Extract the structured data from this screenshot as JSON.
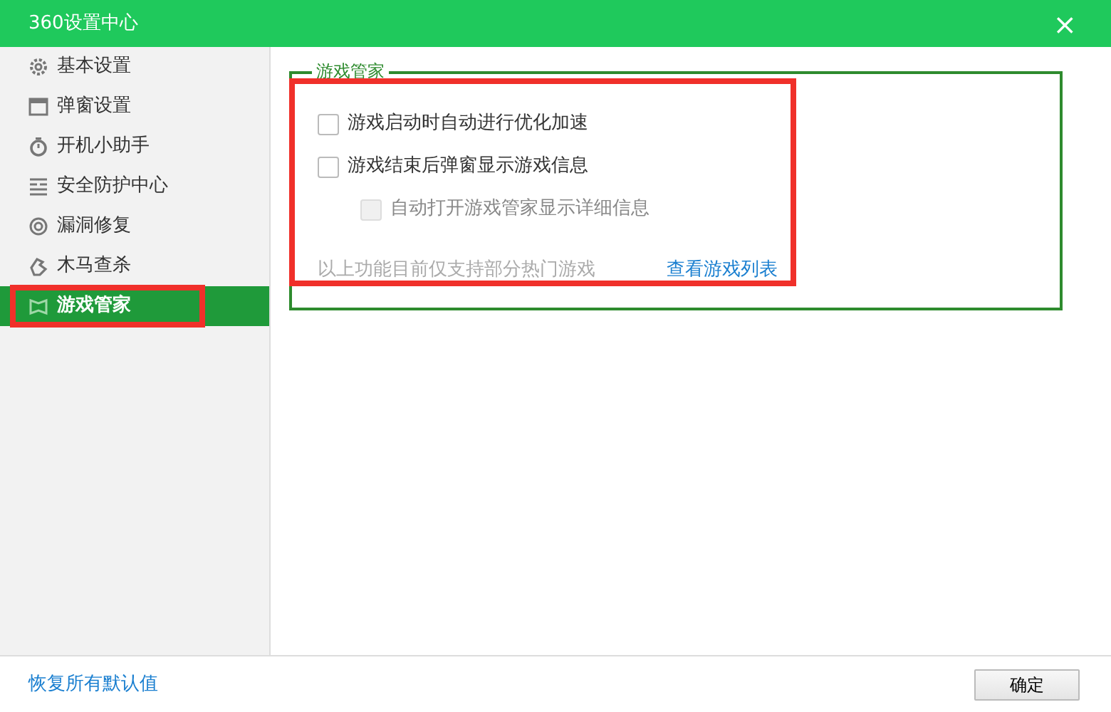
{
  "window": {
    "title": "360设置中心",
    "close": "×"
  },
  "sidebar": {
    "items": [
      {
        "label": "基本设置",
        "selected": false,
        "highlighted": false
      },
      {
        "label": "弹窗设置",
        "selected": false,
        "highlighted": false
      },
      {
        "label": "开机小助手",
        "selected": false,
        "highlighted": false
      },
      {
        "label": "安全防护中心",
        "selected": false,
        "highlighted": false
      },
      {
        "label": "漏洞修复",
        "selected": false,
        "highlighted": false
      },
      {
        "label": "木马查杀",
        "selected": false,
        "highlighted": false
      },
      {
        "label": "游戏管家",
        "selected": true,
        "highlighted": true
      }
    ]
  },
  "group": {
    "title": "游戏管家",
    "highlighted": true,
    "options": [
      {
        "label": "游戏启动时自动进行优化加速",
        "checked": false,
        "disabled": false
      },
      {
        "label": "游戏结束后弹窗显示游戏信息",
        "checked": false,
        "disabled": false,
        "children": [
          {
            "label": "自动打开游戏管家显示详细信息",
            "checked": false,
            "disabled": true
          }
        ]
      }
    ],
    "note": "以上功能目前仅支持部分热门游戏",
    "link": "查看游戏列表"
  },
  "footer": {
    "reset_link": "恢复所有默认值",
    "ok_button": "确定"
  }
}
